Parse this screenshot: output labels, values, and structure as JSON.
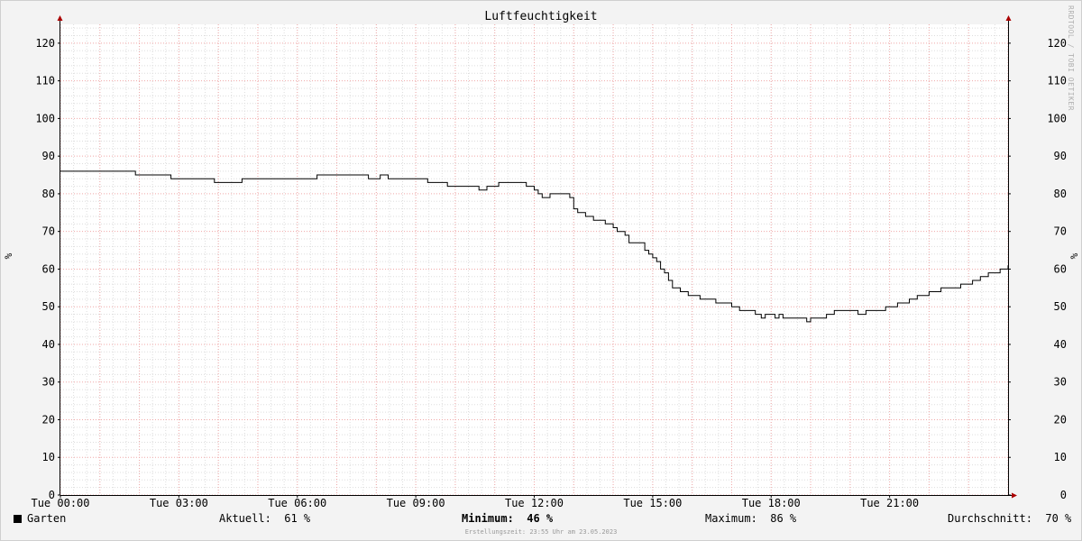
{
  "chart_data": {
    "type": "line",
    "title": "Luftfeuchtigkeit",
    "ylabel": "%",
    "ylim": [
      0,
      125
    ],
    "yticks": [
      0,
      10,
      20,
      30,
      40,
      50,
      60,
      70,
      80,
      90,
      100,
      110,
      120
    ],
    "xlim": [
      0,
      24
    ],
    "xticks": [
      {
        "x": 0,
        "label": "Tue 00:00"
      },
      {
        "x": 3,
        "label": "Tue 03:00"
      },
      {
        "x": 6,
        "label": "Tue 06:00"
      },
      {
        "x": 9,
        "label": "Tue 09:00"
      },
      {
        "x": 12,
        "label": "Tue 12:00"
      },
      {
        "x": 15,
        "label": "Tue 15:00"
      },
      {
        "x": 18,
        "label": "Tue 18:00"
      },
      {
        "x": 21,
        "label": "Tue 21:00"
      }
    ],
    "grid": true,
    "series": [
      {
        "name": "Garten",
        "color": "#000000",
        "step": true,
        "points": [
          [
            0.0,
            86
          ],
          [
            1.9,
            85
          ],
          [
            2.8,
            84
          ],
          [
            3.9,
            83
          ],
          [
            4.6,
            84
          ],
          [
            6.5,
            85
          ],
          [
            7.8,
            84
          ],
          [
            8.1,
            85
          ],
          [
            8.3,
            84
          ],
          [
            9.3,
            83
          ],
          [
            9.8,
            82
          ],
          [
            10.6,
            81
          ],
          [
            10.8,
            82
          ],
          [
            11.1,
            83
          ],
          [
            11.8,
            82
          ],
          [
            12.0,
            81
          ],
          [
            12.1,
            80
          ],
          [
            12.2,
            79
          ],
          [
            12.4,
            80
          ],
          [
            12.9,
            79
          ],
          [
            13.0,
            76
          ],
          [
            13.1,
            75
          ],
          [
            13.3,
            74
          ],
          [
            13.5,
            73
          ],
          [
            13.8,
            72
          ],
          [
            14.0,
            71
          ],
          [
            14.1,
            70
          ],
          [
            14.3,
            69
          ],
          [
            14.4,
            67
          ],
          [
            14.8,
            65
          ],
          [
            14.9,
            64
          ],
          [
            15.0,
            63
          ],
          [
            15.1,
            62
          ],
          [
            15.2,
            60
          ],
          [
            15.3,
            59
          ],
          [
            15.4,
            57
          ],
          [
            15.5,
            55
          ],
          [
            15.7,
            54
          ],
          [
            15.9,
            53
          ],
          [
            16.2,
            52
          ],
          [
            16.6,
            51
          ],
          [
            17.0,
            50
          ],
          [
            17.2,
            49
          ],
          [
            17.6,
            48
          ],
          [
            17.75,
            47
          ],
          [
            17.85,
            48
          ],
          [
            18.1,
            47
          ],
          [
            18.2,
            48
          ],
          [
            18.3,
            47
          ],
          [
            18.9,
            46
          ],
          [
            19.0,
            47
          ],
          [
            19.2,
            47
          ],
          [
            19.4,
            48
          ],
          [
            19.6,
            49
          ],
          [
            20.2,
            48
          ],
          [
            20.4,
            49
          ],
          [
            20.9,
            50
          ],
          [
            21.2,
            51
          ],
          [
            21.5,
            52
          ],
          [
            21.7,
            53
          ],
          [
            22.0,
            54
          ],
          [
            22.3,
            55
          ],
          [
            22.8,
            56
          ],
          [
            23.1,
            57
          ],
          [
            23.3,
            58
          ],
          [
            23.5,
            59
          ],
          [
            23.8,
            60
          ],
          [
            24.0,
            61
          ]
        ]
      }
    ]
  },
  "legend": {
    "series_name": "Garten",
    "aktuell_label": "Aktuell:",
    "aktuell_value": "61 %",
    "minimum_label": "Minimum:",
    "minimum_value": "46 %",
    "maximum_label": "Maximum:",
    "maximum_value": "86 %",
    "durchschnitt_label": "Durchschnitt:",
    "durchschnitt_value": "70 %"
  },
  "watermark": "RRDTOOL / TOBI OETIKER",
  "footer": "Erstellungszeit: 23:55 Uhr am 23.05.2023"
}
